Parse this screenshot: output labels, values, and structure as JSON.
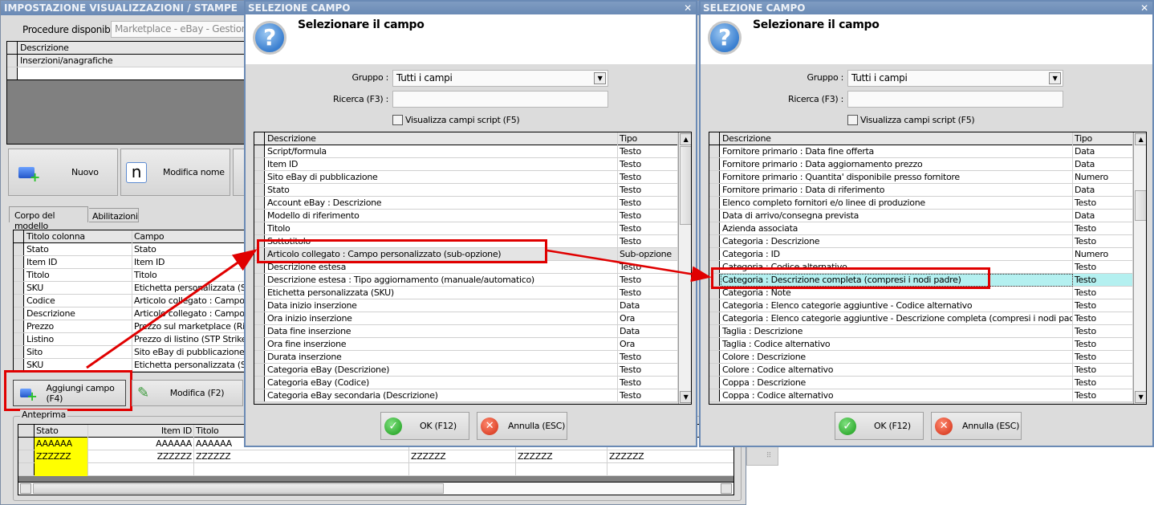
{
  "main": {
    "title": "IMPOSTAZIONE VISUALIZZAZIONI / STAMPE",
    "procedure_label": "Procedure disponibili :",
    "procedure_value": "Marketplace - eBay - Gestion",
    "models_header": "Descrizione",
    "models_rows": [
      "Inserzioni/anagrafiche",
      ""
    ],
    "btn_nuovo": "Nuovo",
    "btn_modifica_nome": "Modifica nome",
    "tabs": [
      "Corpo del modello",
      "Abilitazioni"
    ],
    "columns_headers": [
      "Titolo colonna",
      "Campo"
    ],
    "columns_rows": [
      [
        "Stato",
        "Stato"
      ],
      [
        "Item ID",
        "Item ID"
      ],
      [
        "Titolo",
        "Titolo"
      ],
      [
        "SKU",
        "Etichetta personalizzata (SKU"
      ],
      [
        "Codice",
        "Articolo collegato : Campo pe"
      ],
      [
        "Descrizione",
        "Articolo collegato : Campo pe"
      ],
      [
        "Prezzo",
        "Prezzo sul marketplace (Rilev"
      ],
      [
        "Listino",
        "Prezzo di listino (STP Strike-th"
      ],
      [
        "Sito",
        "Sito eBay di pubblicazione"
      ],
      [
        "SKU",
        "Etichetta personalizzata (SKU"
      ]
    ],
    "btn_aggiungi": "Aggiungi campo (F4)",
    "btn_modifica": "Modifica (F2)",
    "preview_label": "Anteprima",
    "preview_headers": [
      "Stato",
      "Item ID",
      "Titolo",
      "",
      "",
      ""
    ],
    "preview_rows": [
      [
        "AAAAAA",
        "AAAAAA",
        "AAAAAA",
        "",
        "",
        ""
      ],
      [
        "ZZZZZZ",
        "ZZZZZZ",
        "ZZZZZZ",
        "ZZZZZZ",
        "ZZZZZZ",
        "ZZZZZZ"
      ],
      [
        "",
        "",
        "",
        "",
        "",
        ""
      ]
    ]
  },
  "dialogs": [
    {
      "title": "SELEZIONE CAMPO",
      "heading": "Selezionare il campo",
      "gruppo_label": "Gruppo :",
      "gruppo_value": "Tutti i campi",
      "ricerca_label": "Ricerca (F3) :",
      "ricerca_value": "",
      "checkbox_label": "Visualizza campi script (F5)",
      "headers": [
        "Descrizione",
        "Tipo"
      ],
      "selected": 8,
      "rows": [
        [
          "Script/formula",
          "Testo"
        ],
        [
          "Item ID",
          "Testo"
        ],
        [
          "Sito eBay di pubblicazione",
          "Testo"
        ],
        [
          "Stato",
          "Testo"
        ],
        [
          "Account eBay : Descrizione",
          "Testo"
        ],
        [
          "Modello di riferimento",
          "Testo"
        ],
        [
          "Titolo",
          "Testo"
        ],
        [
          "Sottotitolo",
          "Testo"
        ],
        [
          "Articolo collegato : Campo personalizzato (sub-opzione)",
          "Sub-opzione"
        ],
        [
          "Descrizione estesa",
          "Testo"
        ],
        [
          "Descrizione estesa : Tipo aggiornamento (manuale/automatico)",
          "Testo"
        ],
        [
          "Etichetta personalizzata (SKU)",
          "Testo"
        ],
        [
          "Data inizio inserzione",
          "Data"
        ],
        [
          "Ora inizio inserzione",
          "Ora"
        ],
        [
          "Data fine inserzione",
          "Data"
        ],
        [
          "Ora fine inserzione",
          "Ora"
        ],
        [
          "Durata inserzione",
          "Testo"
        ],
        [
          "Categoria eBay (Descrizione)",
          "Testo"
        ],
        [
          "Categoria eBay (Codice)",
          "Testo"
        ],
        [
          "Categoria eBay secondaria (Descrizione)",
          "Testo"
        ]
      ],
      "ok": "OK (F12)",
      "cancel": "Annulla (ESC)"
    },
    {
      "title": "SELEZIONE CAMPO",
      "heading": "Selezionare il campo",
      "gruppo_label": "Gruppo :",
      "gruppo_value": "Tutti i campi",
      "ricerca_label": "Ricerca (F3) :",
      "ricerca_value": "",
      "checkbox_label": "Visualizza campi script (F5)",
      "headers": [
        "Descrizione",
        "Tipo"
      ],
      "selected": 10,
      "rows": [
        [
          "Fornitore primario : Data fine offerta",
          "Data"
        ],
        [
          "Fornitore primario : Data aggiornamento prezzo",
          "Data"
        ],
        [
          "Fornitore primario : Quantita' disponibile presso fornitore",
          "Numero"
        ],
        [
          "Fornitore primario : Data di riferimento",
          "Data"
        ],
        [
          "Elenco completo fornitori e/o linee di produzione",
          "Testo"
        ],
        [
          "Data di arrivo/consegna prevista",
          "Data"
        ],
        [
          "Azienda associata",
          "Testo"
        ],
        [
          "Categoria : Descrizione",
          "Testo"
        ],
        [
          "Categoria : ID",
          "Numero"
        ],
        [
          "Categoria : Codice alternativo",
          "Testo"
        ],
        [
          "Categoria : Descrizione completa (compresi i nodi padre)",
          "Testo"
        ],
        [
          "Categoria : Note",
          "Testo"
        ],
        [
          "Categoria : Elenco categorie aggiuntive - Codice alternativo",
          "Testo"
        ],
        [
          "Categoria : Elenco categorie aggiuntive - Descrizione completa (compresi i nodi padre)",
          "Testo"
        ],
        [
          "Taglia : Descrizione",
          "Testo"
        ],
        [
          "Taglia : Codice alternativo",
          "Testo"
        ],
        [
          "Colore : Descrizione",
          "Testo"
        ],
        [
          "Colore : Codice alternativo",
          "Testo"
        ],
        [
          "Coppa : Descrizione",
          "Testo"
        ],
        [
          "Coppa : Codice alternativo",
          "Testo"
        ]
      ],
      "ok": "OK (F12)",
      "cancel": "Annulla (ESC)"
    }
  ],
  "colors": {
    "selected_row": "#b4f0f0",
    "highlight": "#e00000",
    "preview_stato": "#ffff00"
  }
}
